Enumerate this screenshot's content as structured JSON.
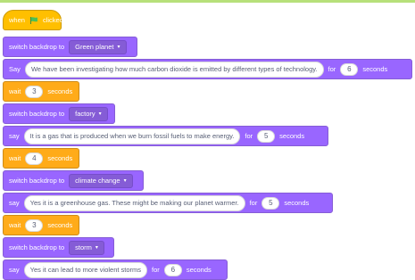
{
  "script": {
    "hat": {
      "text_before": "when",
      "icon": "green-flag-icon",
      "text_after": "clicked",
      "colors": {
        "flag_green": "#4cbf56",
        "events": "#ffbf00"
      }
    },
    "blocks": [
      {
        "type": "switch_backdrop",
        "label": "switch backdrop to",
        "dropdown": "Green planet",
        "caret": "▾"
      },
      {
        "type": "say_for",
        "say_label": "Say",
        "message": "We have been investigating how much carbon dioxide is emitted by different types of technology.",
        "for_label": "for",
        "duration": "6",
        "seconds_label": "seconds"
      },
      {
        "type": "wait",
        "wait_label": "wait",
        "duration": "3",
        "seconds_label": "seconds"
      },
      {
        "type": "switch_backdrop",
        "label": "switch backdrop to",
        "dropdown": "factory",
        "caret": "▾"
      },
      {
        "type": "say_for",
        "say_label": "say",
        "message": "It is a gas that is produced when we burn fossil fuels to make energy.",
        "for_label": "for",
        "duration": "5",
        "seconds_label": "seconds"
      },
      {
        "type": "wait",
        "wait_label": "wait",
        "duration": "4",
        "seconds_label": "seconds"
      },
      {
        "type": "switch_backdrop",
        "label": "switch backdrop to",
        "dropdown": "climate change",
        "caret": "▾"
      },
      {
        "type": "say_for",
        "say_label": "say",
        "message": "Yes it is a greenhouse gas. These might be making our planet warmer.",
        "for_label": "for",
        "duration": "5",
        "seconds_label": "seconds"
      },
      {
        "type": "wait",
        "wait_label": "wait",
        "duration": "3",
        "seconds_label": "seconds"
      },
      {
        "type": "switch_backdrop",
        "label": "switch backdrop to",
        "dropdown": "storm",
        "caret": "▾"
      },
      {
        "type": "say_for",
        "say_label": "say",
        "message": "Yes it can lead to more violent storms",
        "for_label": "for",
        "duration": "6",
        "seconds_label": "seconds"
      }
    ],
    "colors": {
      "looks": "#9966ff",
      "control": "#ffab19",
      "events": "#ffbf00"
    }
  }
}
